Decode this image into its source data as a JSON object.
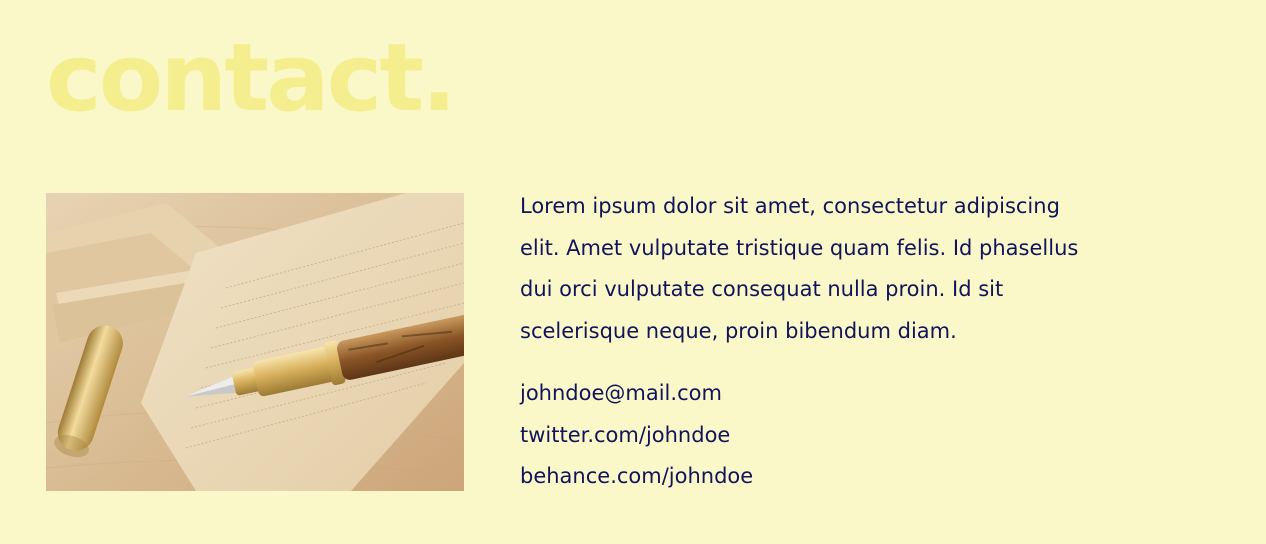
{
  "contact": {
    "title": "contact.",
    "image_subject": "fountain pen on envelopes",
    "intro": [
      "Lorem ipsum dolor sit amet, consectetur adipiscing",
      "elit. Amet vulputate tristique quam felis. Id phasellus",
      "dui orci vulputate consequat nulla proin. Id sit",
      "scelerisque neque, proin bibendum diam."
    ],
    "links": [
      "johndoe@mail.com",
      "twitter.com/johndoe",
      "behance.com/johndoe"
    ]
  },
  "colors": {
    "background": "#FAF8C9",
    "title": "#F4EE8E",
    "text": "#11145A"
  }
}
